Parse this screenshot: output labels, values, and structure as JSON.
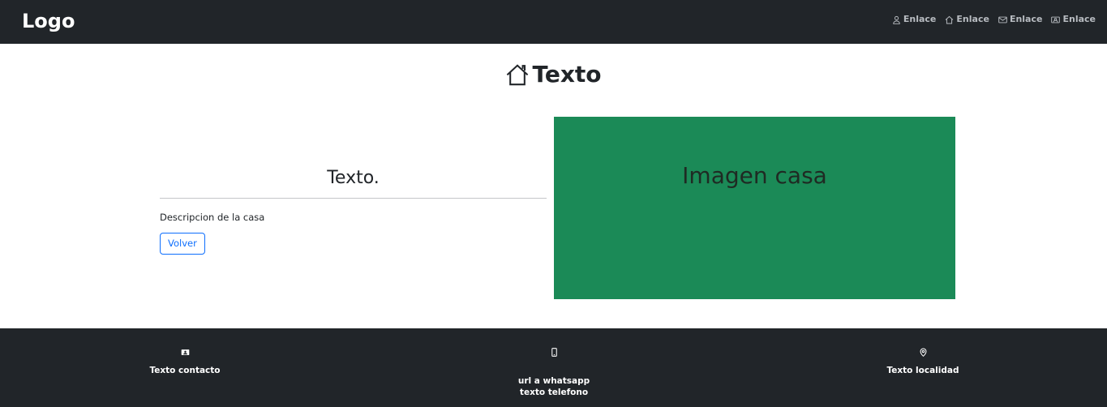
{
  "header": {
    "logo": "Logo",
    "links": [
      {
        "label": "Enlace",
        "icon": "person-icon"
      },
      {
        "label": "Enlace",
        "icon": "house-icon"
      },
      {
        "label": "Enlace",
        "icon": "envelope-icon"
      },
      {
        "label": "Enlace",
        "icon": "contact-card-icon"
      }
    ]
  },
  "main": {
    "title": "Texto",
    "title_icon": "house-icon",
    "card_title": "Texto.",
    "description": "Descripcion de la casa",
    "back_button": "Volver",
    "image_label": "Imagen casa",
    "image_color": "#1b8a57"
  },
  "footer": {
    "contact": {
      "icon": "contact-card-icon",
      "text": "Texto contacto"
    },
    "whatsapp": {
      "icon": "phone-icon",
      "link": "url a whatsapp",
      "text": "texto telefono"
    },
    "location": {
      "icon": "location-pin-icon",
      "text": "Texto localidad"
    }
  },
  "colors": {
    "navbar": "#212529",
    "accent": "#0d6efd",
    "image": "#1b8a57"
  }
}
